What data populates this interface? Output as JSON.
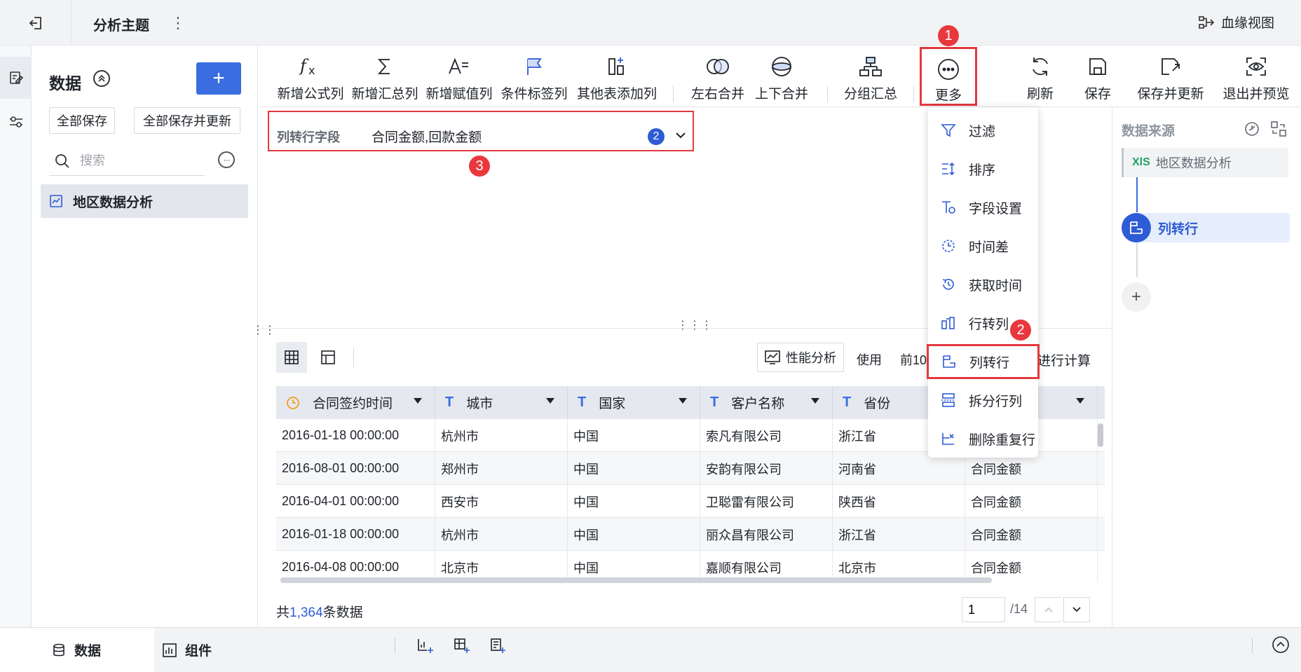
{
  "topbar": {
    "title": "分析主题",
    "more_glyph": "⋮",
    "lineage_label": "血缘视图",
    "lineage_icon": "lineage-icon"
  },
  "rail": {
    "items": [
      {
        "name": "data-edit-icon",
        "active": true
      },
      {
        "name": "settings-sliders-icon",
        "active": false
      }
    ]
  },
  "data_panel": {
    "title": "数据",
    "add_label": "+",
    "save_all_label": "全部保存",
    "save_all_update_label": "全部保存并更新",
    "search_placeholder": "搜索",
    "more_glyph": "···",
    "dataset_label": "地区数据分析"
  },
  "toolbar": {
    "items": [
      {
        "label": "新增公式列",
        "icon": "formula-icon"
      },
      {
        "label": "新增汇总列",
        "icon": "sigma-icon"
      },
      {
        "label": "新增赋值列",
        "icon": "assign-icon"
      },
      {
        "label": "条件标签列",
        "icon": "flag-icon"
      },
      {
        "label": "其他表添加列",
        "icon": "add-column-icon"
      },
      {
        "label": "左右合并",
        "icon": "merge-horizontal-icon"
      },
      {
        "label": "上下合并",
        "icon": "merge-vertical-icon"
      },
      {
        "label": "分组汇总",
        "icon": "group-summary-icon"
      },
      {
        "label": "更多",
        "icon": "more-circle-icon"
      },
      {
        "label": "刷新",
        "icon": "refresh-icon"
      },
      {
        "label": "保存",
        "icon": "save-icon"
      },
      {
        "label": "保存并更新",
        "icon": "save-update-icon"
      },
      {
        "label": "退出并预览",
        "icon": "eye-icon"
      }
    ]
  },
  "config": {
    "field_label": "列转行字段",
    "field_value": "合同金额,回款金额",
    "field_count": "2"
  },
  "annotations": {
    "marker_1": "1",
    "marker_2": "2",
    "marker_3": "3"
  },
  "menu": {
    "items": [
      {
        "label": "过滤",
        "icon": "filter-icon"
      },
      {
        "label": "排序",
        "icon": "sort-icon"
      },
      {
        "label": "字段设置",
        "icon": "field-settings-icon"
      },
      {
        "label": "时间差",
        "icon": "time-diff-icon"
      },
      {
        "label": "获取时间",
        "icon": "get-time-icon"
      },
      {
        "label": "行转列",
        "icon": "row-to-column-icon"
      },
      {
        "label": "列转行",
        "icon": "column-to-row-icon",
        "highlighted": true
      },
      {
        "label": "拆分行列",
        "icon": "split-icon"
      },
      {
        "label": "删除重复行",
        "icon": "dedupe-icon"
      }
    ]
  },
  "table_toolbar": {
    "perf_label": "性能分析",
    "use_label": "使用",
    "rows_value": "前10",
    "calc_text": "进行计算"
  },
  "table": {
    "columns": [
      {
        "label": "合同签约时间",
        "type_icon": "clock-icon"
      },
      {
        "label": "城市",
        "type_icon": "text-type-icon"
      },
      {
        "label": "国家",
        "type_icon": "text-type-icon"
      },
      {
        "label": "客户名称",
        "type_icon": "text-type-icon"
      },
      {
        "label": "省份",
        "type_icon": "text-type-icon"
      },
      {
        "label": "",
        "type_icon": ""
      }
    ],
    "rows": [
      [
        "2016-01-18 00:00:00",
        "杭州市",
        "中国",
        "索凡有限公司",
        "浙江省",
        ""
      ],
      [
        "2016-08-01 00:00:00",
        "郑州市",
        "中国",
        "安韵有限公司",
        "河南省",
        "合同金额"
      ],
      [
        "2016-04-01 00:00:00",
        "西安市",
        "中国",
        "卫聪雷有限公司",
        "陕西省",
        "合同金额"
      ],
      [
        "2016-01-18 00:00:00",
        "杭州市",
        "中国",
        "丽众昌有限公司",
        "浙江省",
        "合同金额"
      ],
      [
        "2016-04-08 00:00:00",
        "北京市",
        "中国",
        "嘉顺有限公司",
        "北京市",
        "合同金额"
      ]
    ]
  },
  "pagination": {
    "total_prefix": "共",
    "total_count": "1,364",
    "total_suffix": "条数据",
    "current_page": "1",
    "total_pages": "/14"
  },
  "right_panel": {
    "title": "数据来源",
    "source_label": "地区数据分析",
    "source_icon_text": "XlS",
    "step_label": "列转行",
    "add_label": "+"
  },
  "bottombar": {
    "data_tab": "数据",
    "component_tab": "组件"
  },
  "colors": {
    "accent": "#2e5bd6",
    "highlight_red": "#e1393f",
    "xls_green": "#21a366"
  }
}
